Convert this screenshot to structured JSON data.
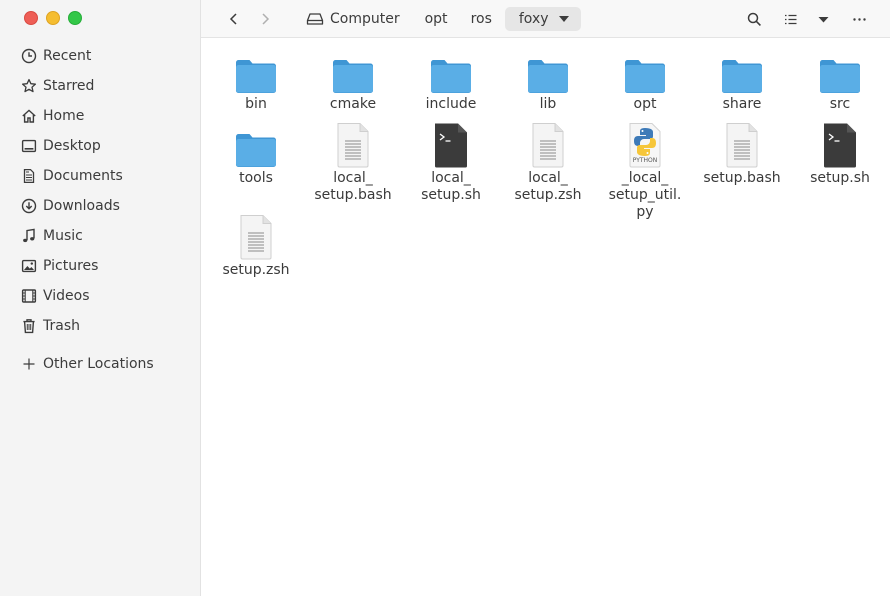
{
  "sidebar": {
    "items": [
      {
        "label": "Recent",
        "icon": "clock-icon"
      },
      {
        "label": "Starred",
        "icon": "star-icon"
      },
      {
        "label": "Home",
        "icon": "home-icon"
      },
      {
        "label": "Desktop",
        "icon": "desktop-icon"
      },
      {
        "label": "Documents",
        "icon": "document-icon"
      },
      {
        "label": "Downloads",
        "icon": "download-icon"
      },
      {
        "label": "Music",
        "icon": "music-icon"
      },
      {
        "label": "Pictures",
        "icon": "picture-icon"
      },
      {
        "label": "Videos",
        "icon": "video-icon"
      },
      {
        "label": "Trash",
        "icon": "trash-icon"
      }
    ],
    "other_locations": "Other Locations"
  },
  "breadcrumb": {
    "root": "Computer",
    "parts": [
      "opt",
      "ros"
    ],
    "current": "foxy"
  },
  "files": [
    {
      "lines": [
        "bin"
      ],
      "type": "folder"
    },
    {
      "lines": [
        "cmake"
      ],
      "type": "folder"
    },
    {
      "lines": [
        "include"
      ],
      "type": "folder"
    },
    {
      "lines": [
        "lib"
      ],
      "type": "folder"
    },
    {
      "lines": [
        "opt"
      ],
      "type": "folder"
    },
    {
      "lines": [
        "share"
      ],
      "type": "folder"
    },
    {
      "lines": [
        "src"
      ],
      "type": "folder"
    },
    {
      "lines": [
        "tools"
      ],
      "type": "folder"
    },
    {
      "lines": [
        "local_",
        "setup.bash"
      ],
      "type": "text"
    },
    {
      "lines": [
        "local_",
        "setup.sh"
      ],
      "type": "script"
    },
    {
      "lines": [
        "local_",
        "setup.zsh"
      ],
      "type": "text"
    },
    {
      "lines": [
        "_local_",
        "setup_util.",
        "py"
      ],
      "type": "python",
      "badge": "PYTHON"
    },
    {
      "lines": [
        "setup.bash"
      ],
      "type": "text"
    },
    {
      "lines": [
        "setup.sh"
      ],
      "type": "script"
    },
    {
      "lines": [
        "setup.zsh"
      ],
      "type": "text"
    }
  ],
  "colors": {
    "folder": "#5aaee6",
    "folder_dark": "#3f96d4",
    "script": "#3b3b3b",
    "python_blue": "#3d7ab8",
    "python_yellow": "#f6c63a"
  }
}
